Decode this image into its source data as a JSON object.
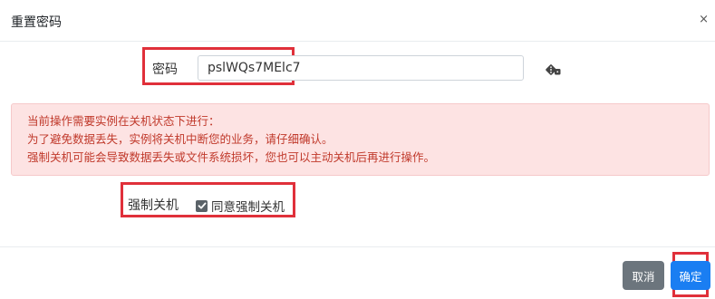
{
  "dialog": {
    "title": "重置密码",
    "close_label": "×"
  },
  "password": {
    "label": "密码",
    "value": "pslWQs7MElc7",
    "generate_icon": "dice-icon"
  },
  "alert": {
    "line1": "当前操作需要实例在关机状态下进行：",
    "line2": "为了避免数据丢失，实例将关机中断您的业务，请仔细确认。",
    "line3": "强制关机可能会导致数据丢失或文件系统损坏，您也可以主动关机后再进行操作。"
  },
  "force_shutdown": {
    "label": "强制关机",
    "checkbox_label": "同意强制关机",
    "checked": true
  },
  "footer": {
    "cancel_label": "取消",
    "ok_label": "确定"
  },
  "colors": {
    "highlight": "#e0303a",
    "primary": "#1a7ef2",
    "secondary": "#6c757d",
    "alert_bg": "#fde3e3",
    "alert_text": "#c0392b"
  }
}
